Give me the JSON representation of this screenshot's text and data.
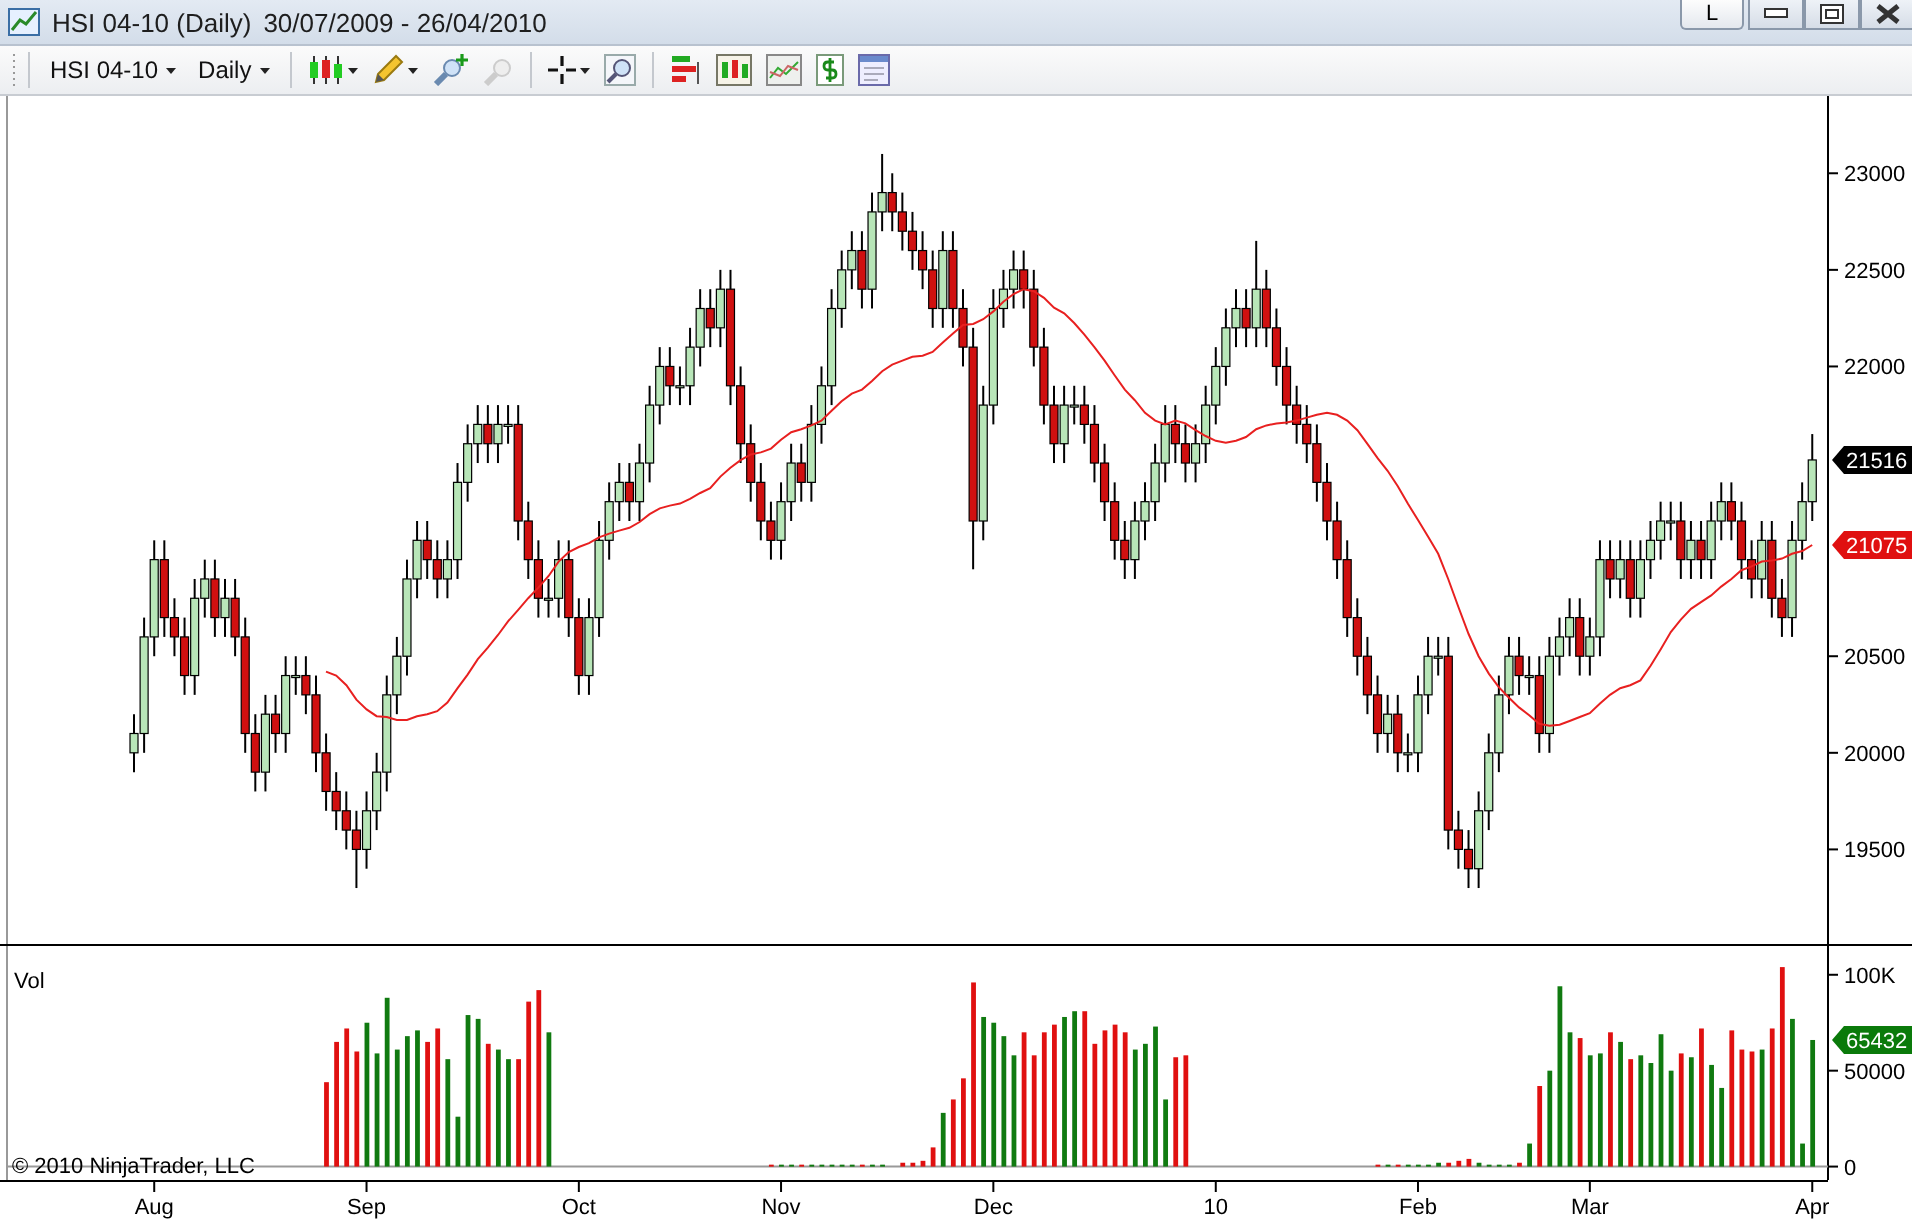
{
  "window": {
    "title": "HSI 04-10 (Daily)",
    "date_range": "30/07/2009 - 26/04/2010",
    "link_button": "L"
  },
  "toolbar": {
    "instrument": "HSI 04-10",
    "interval": "Daily"
  },
  "price_panel": {
    "last_price": "21516",
    "average_value": "21075",
    "chart_data": {
      "type": "candlestick",
      "ylim": [
        19000,
        23400
      ],
      "yticks": [
        19500,
        20000,
        20500,
        22000,
        22500,
        23000
      ],
      "categories": [
        null,
        null,
        null,
        null,
        null,
        null,
        null,
        null,
        null,
        null,
        null,
        null,
        null,
        null,
        null,
        null,
        null,
        null,
        null,
        null,
        null,
        null,
        null,
        null,
        null,
        null,
        null,
        null,
        null,
        null,
        null,
        null,
        null,
        null,
        null,
        null,
        null,
        null,
        null,
        null,
        null,
        null,
        null,
        null,
        null,
        null,
        null,
        null,
        null,
        null,
        null,
        null,
        null,
        null,
        null,
        null,
        null,
        null,
        null,
        null,
        null,
        null,
        null,
        null,
        null,
        null,
        null,
        null,
        null,
        null,
        null,
        null,
        null,
        null,
        null,
        null,
        null,
        null,
        null,
        null,
        null,
        null,
        null,
        null,
        null,
        null,
        null,
        null,
        null,
        null,
        null,
        null,
        null,
        null,
        null,
        null,
        null,
        null,
        null,
        null,
        null,
        null,
        null,
        null,
        null,
        null,
        null,
        null,
        null,
        null,
        null,
        null,
        null,
        null,
        null,
        null,
        null,
        null,
        null,
        null,
        null,
        null,
        null,
        null,
        null,
        null,
        null,
        null,
        null,
        null,
        null,
        null,
        null,
        null,
        null,
        null,
        null,
        null,
        null,
        null,
        null,
        null,
        null,
        null,
        null,
        null,
        null,
        null,
        null,
        null,
        null,
        null,
        null,
        null,
        null,
        null,
        null,
        null,
        null,
        null,
        null,
        null,
        null,
        null,
        null,
        null,
        null
      ],
      "ohlc": [
        [
          20000,
          20200,
          19900,
          20100
        ],
        [
          20100,
          20700,
          20000,
          20600
        ],
        [
          20600,
          21100,
          20500,
          21000
        ],
        [
          21000,
          21100,
          20600,
          20700
        ],
        [
          20700,
          20800,
          20500,
          20600
        ],
        [
          20600,
          20700,
          20300,
          20400
        ],
        [
          20400,
          20900,
          20300,
          20800
        ],
        [
          20800,
          21000,
          20700,
          20900
        ],
        [
          20900,
          21000,
          20600,
          20700
        ],
        [
          20700,
          20900,
          20600,
          20800
        ],
        [
          20800,
          20900,
          20500,
          20600
        ],
        [
          20600,
          20700,
          20000,
          20100
        ],
        [
          20100,
          20200,
          19800,
          19900
        ],
        [
          19900,
          20300,
          19800,
          20200
        ],
        [
          20200,
          20300,
          20000,
          20100
        ],
        [
          20100,
          20500,
          20000,
          20400
        ],
        [
          20400,
          20500,
          20300,
          20400
        ],
        [
          20400,
          20500,
          20200,
          20300
        ],
        [
          20300,
          20400,
          19900,
          20000
        ],
        [
          20000,
          20100,
          19700,
          19800
        ],
        [
          19800,
          19900,
          19600,
          19700
        ],
        [
          19700,
          19800,
          19500,
          19600
        ],
        [
          19600,
          19700,
          19300,
          19500
        ],
        [
          19500,
          19800,
          19400,
          19700
        ],
        [
          19700,
          20000,
          19600,
          19900
        ],
        [
          19900,
          20400,
          19800,
          20300
        ],
        [
          20300,
          20600,
          20200,
          20500
        ],
        [
          20500,
          21000,
          20400,
          20900
        ],
        [
          20900,
          21200,
          20800,
          21100
        ],
        [
          21100,
          21200,
          20900,
          21000
        ],
        [
          21000,
          21100,
          20800,
          20900
        ],
        [
          20900,
          21100,
          20800,
          21000
        ],
        [
          21000,
          21500,
          20900,
          21400
        ],
        [
          21400,
          21700,
          21300,
          21600
        ],
        [
          21600,
          21800,
          21500,
          21700
        ],
        [
          21700,
          21800,
          21500,
          21600
        ],
        [
          21600,
          21800,
          21500,
          21700
        ],
        [
          21700,
          21800,
          21600,
          21700
        ],
        [
          21700,
          21800,
          21100,
          21200
        ],
        [
          21200,
          21300,
          20900,
          21000
        ],
        [
          21000,
          21100,
          20700,
          20800
        ],
        [
          20800,
          20900,
          20700,
          20800
        ],
        [
          20800,
          21100,
          20700,
          21000
        ],
        [
          21000,
          21100,
          20600,
          20700
        ],
        [
          20700,
          20800,
          20300,
          20400
        ],
        [
          20400,
          20800,
          20300,
          20700
        ],
        [
          20700,
          21200,
          20600,
          21100
        ],
        [
          21100,
          21400,
          21000,
          21300
        ],
        [
          21300,
          21500,
          21200,
          21400
        ],
        [
          21400,
          21500,
          21200,
          21300
        ],
        [
          21300,
          21600,
          21200,
          21500
        ],
        [
          21500,
          21900,
          21400,
          21800
        ],
        [
          21800,
          22100,
          21700,
          22000
        ],
        [
          22000,
          22100,
          21800,
          21900
        ],
        [
          21900,
          22000,
          21800,
          21900
        ],
        [
          21900,
          22200,
          21800,
          22100
        ],
        [
          22100,
          22400,
          22000,
          22300
        ],
        [
          22300,
          22400,
          22100,
          22200
        ],
        [
          22200,
          22500,
          22100,
          22400
        ],
        [
          22400,
          22500,
          21800,
          21900
        ],
        [
          21900,
          22000,
          21500,
          21600
        ],
        [
          21600,
          21700,
          21300,
          21400
        ],
        [
          21400,
          21500,
          21100,
          21200
        ],
        [
          21200,
          21300,
          21000,
          21100
        ],
        [
          21100,
          21400,
          21000,
          21300
        ],
        [
          21300,
          21600,
          21200,
          21500
        ],
        [
          21500,
          21600,
          21300,
          21400
        ],
        [
          21400,
          21800,
          21300,
          21700
        ],
        [
          21700,
          22000,
          21600,
          21900
        ],
        [
          21900,
          22400,
          21800,
          22300
        ],
        [
          22300,
          22600,
          22200,
          22500
        ],
        [
          22500,
          22700,
          22400,
          22600
        ],
        [
          22600,
          22700,
          22300,
          22400
        ],
        [
          22400,
          22900,
          22300,
          22800
        ],
        [
          22800,
          23100,
          22700,
          22900
        ],
        [
          22900,
          23000,
          22700,
          22800
        ],
        [
          22800,
          22900,
          22600,
          22700
        ],
        [
          22700,
          22800,
          22500,
          22600
        ],
        [
          22600,
          22700,
          22400,
          22500
        ],
        [
          22500,
          22600,
          22200,
          22300
        ],
        [
          22300,
          22700,
          22200,
          22600
        ],
        [
          22600,
          22700,
          22200,
          22300
        ],
        [
          22300,
          22400,
          22000,
          22100
        ],
        [
          22100,
          22200,
          20950,
          21200
        ],
        [
          21200,
          21900,
          21100,
          21800
        ],
        [
          21800,
          22400,
          21700,
          22300
        ],
        [
          22300,
          22500,
          22200,
          22400
        ],
        [
          22400,
          22600,
          22300,
          22500
        ],
        [
          22500,
          22600,
          22300,
          22400
        ],
        [
          22400,
          22500,
          22000,
          22100
        ],
        [
          22100,
          22200,
          21700,
          21800
        ],
        [
          21800,
          21900,
          21500,
          21600
        ],
        [
          21600,
          21900,
          21500,
          21800
        ],
        [
          21800,
          21900,
          21700,
          21800
        ],
        [
          21800,
          21900,
          21600,
          21700
        ],
        [
          21700,
          21800,
          21400,
          21500
        ],
        [
          21500,
          21600,
          21200,
          21300
        ],
        [
          21300,
          21400,
          21000,
          21100
        ],
        [
          21100,
          21200,
          20900,
          21000
        ],
        [
          21000,
          21300,
          20900,
          21200
        ],
        [
          21200,
          21400,
          21100,
          21300
        ],
        [
          21300,
          21600,
          21200,
          21500
        ],
        [
          21500,
          21800,
          21400,
          21700
        ],
        [
          21700,
          21800,
          21500,
          21600
        ],
        [
          21600,
          21700,
          21400,
          21500
        ],
        [
          21500,
          21700,
          21400,
          21600
        ],
        [
          21600,
          21900,
          21500,
          21800
        ],
        [
          21800,
          22100,
          21700,
          22000
        ],
        [
          22000,
          22300,
          21900,
          22200
        ],
        [
          22200,
          22400,
          22100,
          22300
        ],
        [
          22300,
          22400,
          22100,
          22200
        ],
        [
          22200,
          22650,
          22100,
          22400
        ],
        [
          22400,
          22500,
          22100,
          22200
        ],
        [
          22200,
          22300,
          21900,
          22000
        ],
        [
          22000,
          22100,
          21700,
          21800
        ],
        [
          21800,
          21900,
          21600,
          21700
        ],
        [
          21700,
          21800,
          21500,
          21600
        ],
        [
          21600,
          21700,
          21300,
          21400
        ],
        [
          21400,
          21500,
          21100,
          21200
        ],
        [
          21200,
          21300,
          20900,
          21000
        ],
        [
          21000,
          21100,
          20600,
          20700
        ],
        [
          20700,
          20800,
          20400,
          20500
        ],
        [
          20500,
          20600,
          20200,
          20300
        ],
        [
          20300,
          20400,
          20000,
          20100
        ],
        [
          20100,
          20300,
          20000,
          20200
        ],
        [
          20200,
          20300,
          19900,
          20000
        ],
        [
          20000,
          20100,
          19900,
          20000
        ],
        [
          20000,
          20400,
          19900,
          20300
        ],
        [
          20300,
          20600,
          20200,
          20500
        ],
        [
          20500,
          20600,
          20400,
          20500
        ],
        [
          20500,
          20600,
          19500,
          19600
        ],
        [
          19600,
          19700,
          19400,
          19500
        ],
        [
          19500,
          19600,
          19300,
          19400
        ],
        [
          19400,
          19800,
          19300,
          19700
        ],
        [
          19700,
          20100,
          19600,
          20000
        ],
        [
          20000,
          20400,
          19900,
          20300
        ],
        [
          20300,
          20600,
          20200,
          20500
        ],
        [
          20500,
          20600,
          20300,
          20400
        ],
        [
          20400,
          20500,
          20300,
          20400
        ],
        [
          20400,
          20500,
          20000,
          20100
        ],
        [
          20100,
          20600,
          20000,
          20500
        ],
        [
          20500,
          20700,
          20400,
          20600
        ],
        [
          20600,
          20800,
          20500,
          20700
        ],
        [
          20700,
          20800,
          20400,
          20500
        ],
        [
          20500,
          20700,
          20400,
          20600
        ],
        [
          20600,
          21100,
          20500,
          21000
        ],
        [
          21000,
          21100,
          20800,
          20900
        ],
        [
          20900,
          21100,
          20800,
          21000
        ],
        [
          21000,
          21100,
          20700,
          20800
        ],
        [
          20800,
          21100,
          20700,
          21000
        ],
        [
          21000,
          21200,
          20900,
          21100
        ],
        [
          21100,
          21300,
          21000,
          21200
        ],
        [
          21200,
          21300,
          21100,
          21200
        ],
        [
          21200,
          21300,
          20900,
          21000
        ],
        [
          21000,
          21200,
          20900,
          21100
        ],
        [
          21100,
          21200,
          20900,
          21000
        ],
        [
          21000,
          21300,
          20900,
          21200
        ],
        [
          21200,
          21400,
          21100,
          21300
        ],
        [
          21300,
          21400,
          21100,
          21200
        ],
        [
          21200,
          21300,
          20900,
          21000
        ],
        [
          21000,
          21100,
          20800,
          20900
        ],
        [
          20900,
          21200,
          20800,
          21100
        ],
        [
          21100,
          21200,
          20700,
          20800
        ],
        [
          20800,
          20900,
          20600,
          20700
        ],
        [
          20700,
          21200,
          20600,
          21100
        ],
        [
          21100,
          21400,
          21000,
          21300
        ],
        [
          21300,
          21650,
          21200,
          21516
        ]
      ],
      "series": [
        {
          "type": "line",
          "color": "#e82020",
          "values": [
            null,
            null,
            null,
            null,
            null,
            null,
            null,
            null,
            null,
            null,
            null,
            null,
            null,
            null,
            null,
            null,
            null,
            null,
            null,
            20420,
            20400,
            20350,
            20275,
            20225,
            20190,
            20185,
            20170,
            20170,
            20190,
            20200,
            20215,
            20260,
            20335,
            20405,
            20485,
            20545,
            20610,
            20680,
            20740,
            20800,
            20855,
            20915,
            20990,
            21040,
            21065,
            21085,
            21115,
            21135,
            21150,
            21165,
            21195,
            21235,
            21265,
            21280,
            21290,
            21315,
            21345,
            21370,
            21430,
            21475,
            21515,
            21545,
            21555,
            21575,
            21620,
            21660,
            21675,
            21695,
            21720,
            21770,
            21820,
            21860,
            21880,
            21925,
            21975,
            22010,
            22030,
            22050,
            22055,
            22075,
            22125,
            22170,
            22215,
            22220,
            22245,
            22285,
            22335,
            22375,
            22400,
            22390,
            22355,
            22305,
            22275,
            22225,
            22165,
            22100,
            22030,
            21955,
            21880,
            21825,
            21760,
            21720,
            21700,
            21720,
            21705,
            21670,
            21640,
            21615,
            21605,
            21615,
            21635,
            21675,
            21695,
            21705,
            21710,
            21720,
            21735,
            21750,
            21760,
            21750,
            21720,
            21670,
            21600,
            21525,
            21460,
            21380,
            21290,
            21205,
            21120,
            21030,
            20900,
            20755,
            20615,
            20500,
            20410,
            20340,
            20285,
            20235,
            20195,
            20150,
            20140,
            20145,
            20165,
            20185,
            20205,
            20255,
            20300,
            20335,
            20350,
            20375,
            20450,
            20535,
            20625,
            20690,
            20745,
            20780,
            20815,
            20860,
            20900,
            20945,
            20965,
            20990,
            20995,
            21005,
            21030,
            21045,
            21076
          ]
        }
      ]
    }
  },
  "volume_panel": {
    "last_volume": "65432",
    "copyright": "© 2010 NinjaTrader, LLC",
    "chart_data": {
      "type": "bar",
      "ylim": [
        -7000,
        115000
      ],
      "categories": [
        null,
        null,
        "Aug",
        null,
        null,
        null,
        null,
        null,
        null,
        null,
        null,
        null,
        null,
        null,
        null,
        null,
        null,
        null,
        null,
        null,
        null,
        null,
        null,
        "Sep",
        null,
        null,
        null,
        null,
        null,
        null,
        null,
        null,
        null,
        null,
        null,
        null,
        null,
        null,
        null,
        null,
        null,
        null,
        null,
        null,
        "Oct",
        null,
        null,
        null,
        null,
        null,
        null,
        null,
        null,
        null,
        null,
        null,
        null,
        null,
        null,
        null,
        null,
        null,
        null,
        null,
        "Nov",
        null,
        null,
        null,
        null,
        null,
        null,
        null,
        null,
        null,
        null,
        null,
        null,
        null,
        null,
        null,
        null,
        null,
        null,
        null,
        null,
        "Dec",
        null,
        null,
        null,
        null,
        null,
        null,
        null,
        null,
        null,
        null,
        null,
        null,
        null,
        null,
        null,
        null,
        null,
        null,
        null,
        null,
        null,
        "10",
        null,
        null,
        null,
        null,
        null,
        null,
        null,
        null,
        null,
        null,
        null,
        null,
        null,
        null,
        null,
        null,
        null,
        null,
        null,
        "Feb",
        null,
        null,
        null,
        null,
        null,
        null,
        null,
        null,
        null,
        null,
        null,
        null,
        null,
        null,
        null,
        null,
        "Mar",
        null,
        null,
        null,
        null,
        null,
        null,
        null,
        null,
        null,
        null,
        null,
        null,
        null,
        null,
        null,
        null,
        null,
        null,
        null,
        null,
        null,
        "Apr"
      ],
      "yticks": [
        0,
        50000,
        {
          "value": 100000,
          "label": "100K"
        }
      ],
      "series": [
        {
          "name": "Vol",
          "values": [
            null,
            null,
            null,
            null,
            null,
            null,
            null,
            null,
            null,
            null,
            null,
            null,
            null,
            null,
            null,
            null,
            null,
            null,
            null,
            44000,
            65000,
            72000,
            60000,
            75000,
            59000,
            88000,
            61000,
            68000,
            71000,
            65000,
            72000,
            56000,
            26000,
            79000,
            77000,
            64000,
            61000,
            56000,
            56000,
            86000,
            92000,
            70000,
            null,
            null,
            null,
            null,
            null,
            null,
            null,
            null,
            null,
            null,
            null,
            null,
            null,
            null,
            null,
            null,
            null,
            null,
            null,
            null,
            null,
            1000,
            1000,
            1000,
            1000,
            1000,
            1000,
            1000,
            1000,
            1000,
            1000,
            1000,
            1000,
            null,
            2000,
            2000,
            3000,
            10000,
            28000,
            35000,
            46000,
            96000,
            78000,
            75000,
            68000,
            58000,
            70000,
            58000,
            70000,
            74000,
            78000,
            81000,
            81000,
            64000,
            71000,
            74000,
            70000,
            61000,
            64000,
            73000,
            35000,
            57000,
            58000,
            null,
            null,
            null,
            null,
            null,
            null,
            null,
            null,
            null,
            null,
            null,
            null,
            null,
            null,
            null,
            null,
            null,
            null,
            1000,
            1000,
            1000,
            1000,
            1000,
            1000,
            2000,
            2000,
            3000,
            4000,
            2000,
            1000,
            1000,
            1000,
            2000,
            12000,
            42000,
            50000,
            94000,
            70000,
            67000,
            58000,
            59000,
            70000,
            65000,
            56000,
            58000,
            54000,
            69000,
            50000,
            59000,
            57000,
            72000,
            53000,
            41000,
            71000,
            61000,
            60000,
            61000,
            72000,
            104000,
            77000,
            12000,
            66000
          ]
        }
      ]
    }
  }
}
